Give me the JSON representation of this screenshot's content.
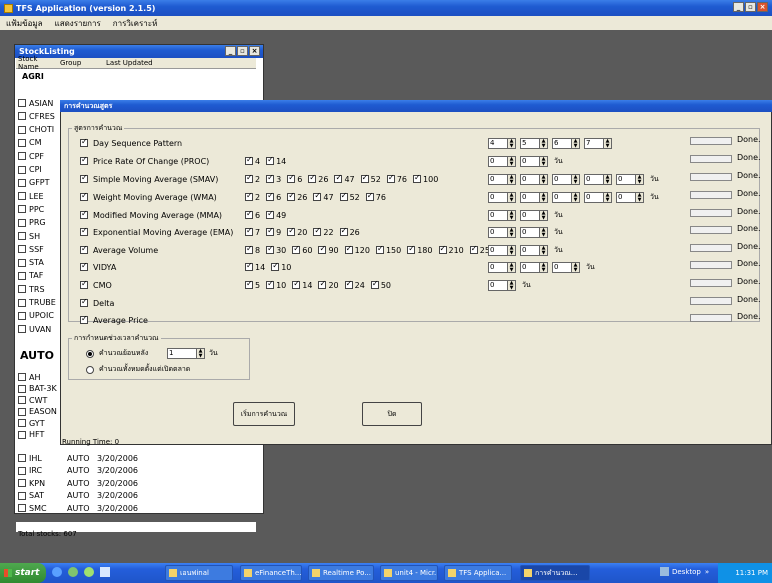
{
  "app": {
    "title": "TFS Application (version 2.1.5)",
    "menus": [
      "แฟ้มข้อมูล",
      "แสดงรายการ",
      "การวิเคราะห์"
    ]
  },
  "stock_window": {
    "title": "StockListing",
    "columns": [
      "Stock Name",
      "Group",
      "Last Updated"
    ],
    "group_agri": "AGRI",
    "agri_stocks": [
      "ASIAN",
      "CFRES",
      "CHOTI",
      "CM",
      "CPF",
      "CPI",
      "GFPT",
      "LEE",
      "PPC",
      "PRG",
      "SH",
      "SSF",
      "STA",
      "TAF",
      "TRS",
      "TRUBE",
      "UPOIC",
      "UVAN"
    ],
    "group_auto": "AUTO",
    "auto_stocks": [
      "AH",
      "BAT-3K",
      "CWT",
      "EASON",
      "GYT",
      "HFT"
    ],
    "rows": [
      {
        "name": "IHL",
        "group": "AUTO",
        "date": "3/20/2006"
      },
      {
        "name": "IRC",
        "group": "AUTO",
        "date": "3/20/2006"
      },
      {
        "name": "KPN",
        "group": "AUTO",
        "date": "3/20/2006"
      },
      {
        "name": "SAT",
        "group": "AUTO",
        "date": "3/20/2006"
      },
      {
        "name": "SMC",
        "group": "AUTO",
        "date": "3/20/2006"
      }
    ],
    "total": "Total stocks: 607"
  },
  "dialog": {
    "title": "การคำนวณสูตร",
    "group_label": "สูตรการคำนวณ",
    "indicators": [
      {
        "label": "Day Sequence Pattern",
        "values": [],
        "spins": [
          "4",
          "5",
          "6",
          "7"
        ],
        "unit": ""
      },
      {
        "label": "Price Rate Of Change (PROC)",
        "values": [
          "4",
          "14"
        ],
        "spins": [
          "0",
          "0"
        ],
        "unit": "วัน"
      },
      {
        "label": "Simple Moving Average (SMAV)",
        "values": [
          "2",
          "3",
          "6",
          "26",
          "47",
          "52",
          "76",
          "100"
        ],
        "spins": [
          "0",
          "0",
          "0",
          "0",
          "0"
        ],
        "unit": "วัน"
      },
      {
        "label": "Weight Moving Average (WMA)",
        "values": [
          "2",
          "6",
          "26",
          "47",
          "52",
          "76"
        ],
        "spins": [
          "0",
          "0",
          "0",
          "0",
          "0"
        ],
        "unit": "วัน"
      },
      {
        "label": "Modified Moving Average (MMA)",
        "values": [
          "6",
          "49"
        ],
        "spins": [
          "0",
          "0"
        ],
        "unit": "วัน"
      },
      {
        "label": "Exponential Moving Average (EMA)",
        "values": [
          "7",
          "9",
          "20",
          "22",
          "26"
        ],
        "spins": [
          "0",
          "0"
        ],
        "unit": "วัน"
      },
      {
        "label": "Average Volume",
        "values": [
          "8",
          "30",
          "60",
          "90",
          "120",
          "150",
          "180",
          "210",
          "250"
        ],
        "spins": [
          "0",
          "0"
        ],
        "unit": "วัน"
      },
      {
        "label": "VIDYA",
        "values": [
          "14",
          "10"
        ],
        "spins": [
          "0",
          "0",
          "0"
        ],
        "unit": "วัน"
      },
      {
        "label": "CMO",
        "values": [
          "5",
          "10",
          "14",
          "20",
          "24",
          "50"
        ],
        "spins": [
          "0"
        ],
        "unit": "วัน"
      },
      {
        "label": "Delta",
        "values": [],
        "spins": [],
        "unit": ""
      },
      {
        "label": "Average Price",
        "values": [],
        "spins": [],
        "unit": ""
      }
    ],
    "done_label": "Done.",
    "period_group": "การกำหนดช่วงเวลาคำนวณ",
    "radio1": "คำนวณย้อนหลัง",
    "radio1_value": "1",
    "radio1_unit": "วัน",
    "radio2": "คำนวณทั้งหมดตั้งแต่เปิดตลาด",
    "start_button": "เริ่มการคำนวณ",
    "close_button": "ปิด",
    "running_time": "Running Time: 0"
  },
  "taskbar": {
    "start": "start",
    "items": [
      "เอนฟinal",
      "eFinanceTh...",
      "Realtime Po...",
      "unit4 - Micr...",
      "TFS Applica...",
      "การคำนวณ..."
    ],
    "desktop": "Desktop",
    "clock": "11:31 PM"
  },
  "colors": {
    "accent": "#1f5bd1",
    "dialog_bg": "#ece9d8"
  }
}
